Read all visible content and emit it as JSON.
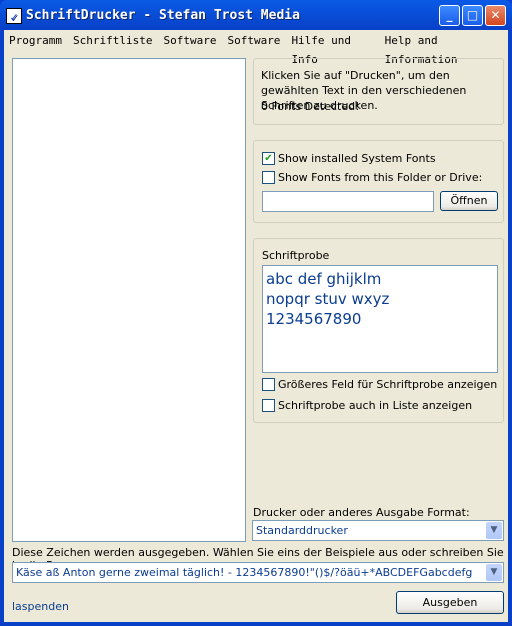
{
  "window": {
    "title": "SchriftDrucker - Stefan Trost Media",
    "app_icon": "printer-glyph-icon",
    "controls": {
      "minimize": "_",
      "maximize": "□",
      "close": "✕"
    }
  },
  "menu": [
    "Programm",
    "Schriftliste",
    "Software",
    "Software",
    "Hilfe und Info",
    "Help and Information"
  ],
  "info": {
    "text": "Klicken Sie auf \"Drucken\", um den gewählten Text in den verschiedenen Schriften zu drucken.",
    "status": "0 Fonts Detected!"
  },
  "source": {
    "system_fonts_label": "Show installed System Fonts",
    "system_fonts_checked": true,
    "folder_label": "Show Fonts from this Folder or Drive:",
    "folder_checked": false,
    "folder_value": "",
    "open_button": "Öffnen"
  },
  "sample": {
    "label": "Schriftprobe",
    "lines": [
      "abc def ghijklm",
      "nopqr stuv wxyz",
      "1234567890"
    ],
    "larger_label": "Größeres Feld für Schriftprobe anzeigen",
    "in_list_label": "Schriftprobe auch in Liste anzeigen"
  },
  "printer": {
    "label": "Drucker oder anderes Ausgabe Format:",
    "value": "Standarddrucker"
  },
  "chars": {
    "label": "Diese Zeichen werden ausgegeben. Wählen Sie eins der Beispiele aus oder schreiben Sie in die Box:",
    "value": "Käse aß Anton gerne zweimal täglich! - 1234567890!\"()$/?öäü+*ABCDEFGabcdefg"
  },
  "footer": {
    "link": "laspenden",
    "output_button": "Ausgeben"
  },
  "colors": {
    "titlebar": "#0A5AE6",
    "face": "#ECE9D8",
    "text_blue": "#0B3D91"
  }
}
